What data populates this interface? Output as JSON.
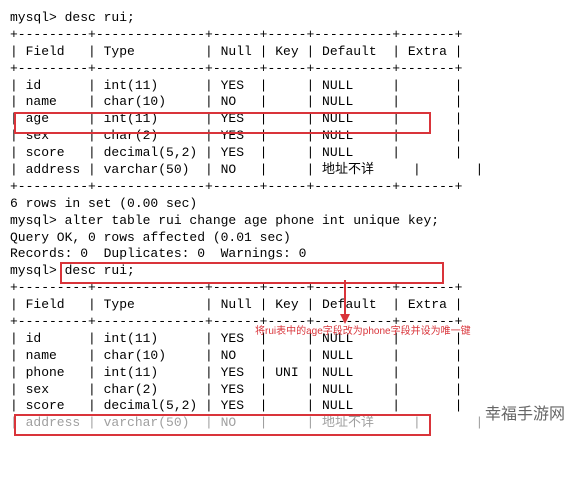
{
  "prompt": "mysql>",
  "cmd_desc1": "desc rui;",
  "cmd_alter": "alter table rui change age phone int unique key;",
  "cmd_desc2": "desc rui;",
  "table_border_top": "+---------+--------------+------+-----+----------+-------+",
  "header": {
    "field": "Field",
    "type": "Type",
    "null": "Null",
    "key": "Key",
    "default": "Default",
    "extra": "Extra"
  },
  "rows1": [
    {
      "field": "id",
      "type": "int(11)",
      "null": "YES",
      "key": "",
      "default": "NULL",
      "extra": ""
    },
    {
      "field": "name",
      "type": "char(10)",
      "null": "NO",
      "key": "",
      "default": "NULL",
      "extra": ""
    },
    {
      "field": "age",
      "type": "int(11)",
      "null": "YES",
      "key": "",
      "default": "NULL",
      "extra": ""
    },
    {
      "field": "sex",
      "type": "char(2)",
      "null": "YES",
      "key": "",
      "default": "NULL",
      "extra": ""
    },
    {
      "field": "score",
      "type": "decimal(5,2)",
      "null": "YES",
      "key": "",
      "default": "NULL",
      "extra": ""
    },
    {
      "field": "address",
      "type": "varchar(50)",
      "null": "NO",
      "key": "",
      "default": "地址不详",
      "extra": ""
    }
  ],
  "summary1": "6 rows in set (0.00 sec)",
  "query_ok": "Query OK, 0 rows affected (0.01 sec)",
  "records": "Records: 0  Duplicates: 0  Warnings: 0",
  "rows2": [
    {
      "field": "id",
      "type": "int(11)",
      "null": "YES",
      "key": "",
      "default": "NULL",
      "extra": ""
    },
    {
      "field": "name",
      "type": "char(10)",
      "null": "NO",
      "key": "",
      "default": "NULL",
      "extra": ""
    },
    {
      "field": "phone",
      "type": "int(11)",
      "null": "YES",
      "key": "UNI",
      "default": "NULL",
      "extra": ""
    },
    {
      "field": "sex",
      "type": "char(2)",
      "null": "YES",
      "key": "",
      "default": "NULL",
      "extra": ""
    },
    {
      "field": "score",
      "type": "decimal(5,2)",
      "null": "YES",
      "key": "",
      "default": "NULL",
      "extra": ""
    },
    {
      "field": "address",
      "type": "varchar(50)",
      "null": "NO",
      "key": "",
      "default": "地址不详",
      "extra": ""
    }
  ],
  "faded_row_index": 5,
  "annotation": "将rui表中的age字段改为phone字段并设为唯一键",
  "watermark": "幸福手游网"
}
